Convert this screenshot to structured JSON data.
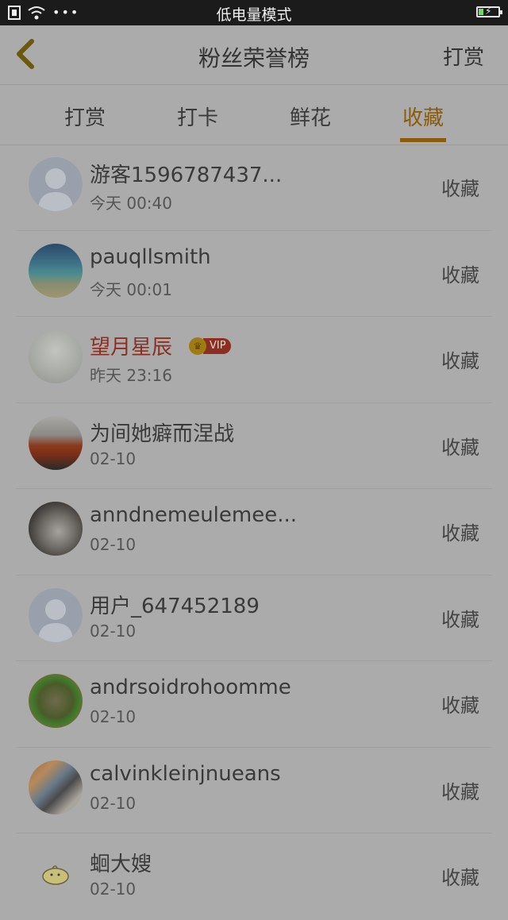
{
  "status_bar": {
    "mode_text": "低电量模式"
  },
  "nav": {
    "title": "粉丝荣誉榜",
    "right_action": "打赏"
  },
  "tabs": [
    {
      "label": "打赏",
      "active": false
    },
    {
      "label": "打卡",
      "active": false
    },
    {
      "label": "鲜花",
      "active": false
    },
    {
      "label": "收藏",
      "active": true
    }
  ],
  "list": [
    {
      "name": "游客1596787437...",
      "time": "今天 00:40",
      "action": "收藏",
      "avatar": "default-avatar-icon"
    },
    {
      "name": "pauqllsmith",
      "time": "今天 00:01",
      "action": "收藏",
      "avatar": "beach-photo"
    },
    {
      "name": "望月星辰",
      "time": "昨天 23:16",
      "action": "收藏",
      "vip": "VIP",
      "avatar": "anime-girl-photo"
    },
    {
      "name": "为间她癖而涅战",
      "time": "02-10",
      "action": "收藏",
      "avatar": "car-photo"
    },
    {
      "name": "anndnemeulemee...",
      "time": "02-10",
      "action": "收藏",
      "avatar": "person-photo"
    },
    {
      "name": "用户_647452189",
      "time": "02-10",
      "action": "收藏",
      "avatar": "default-avatar-icon"
    },
    {
      "name": "andrsoidrohoomme",
      "time": "02-10",
      "action": "收藏",
      "avatar": "illustration-photo"
    },
    {
      "name": "calvinkleinjnueans",
      "time": "02-10",
      "action": "收藏",
      "avatar": "cat-photo"
    },
    {
      "name": "蛔大嫂",
      "time": "02-10",
      "action": "收藏",
      "avatar": "cartoon-blob-icon"
    }
  ]
}
